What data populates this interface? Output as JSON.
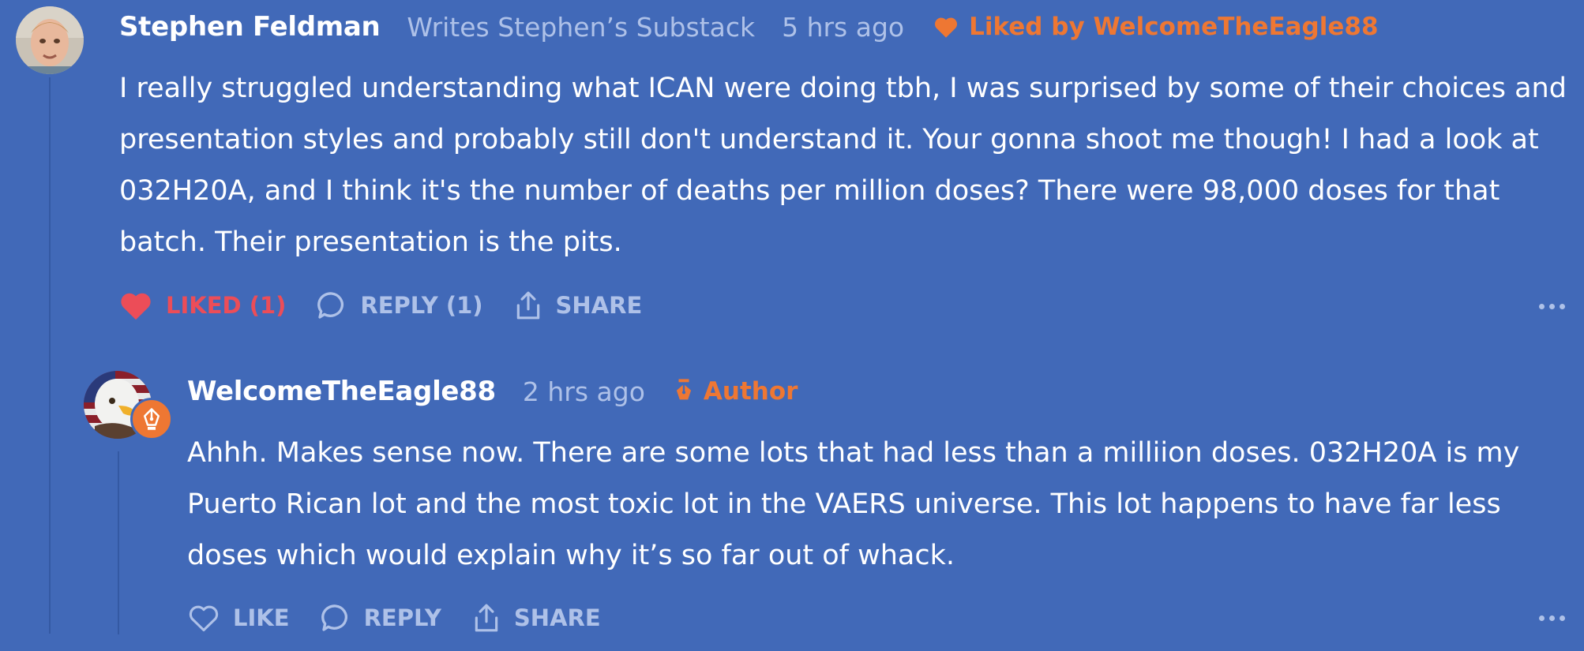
{
  "comments": [
    {
      "author": "Stephen Feldman",
      "subtitle": "Writes Stephen’s Substack",
      "time": "5 hrs ago",
      "liked_by": "Liked by WelcomeTheEagle88",
      "body": "I really struggled understanding what ICAN were doing tbh, I was surprised by some of their choices and presentation styles and probably still don't understand it. Your gonna shoot me though! I had a look at 032H20A, and I think it's the number of deaths per million doses? There were 98,000 doses for that batch. Their presentation is the pits.",
      "actions": {
        "like": "LIKED (1)",
        "reply": "REPLY (1)",
        "share": "SHARE"
      }
    },
    {
      "author": "WelcomeTheEagle88",
      "time": "2 hrs ago",
      "author_tag": "Author",
      "body": "Ahhh. Makes sense now. There are some lots that had less than a milliion doses. 032H20A is my Puerto Rican lot and the most toxic lot in the VAERS universe. This lot happens to have far less doses which would explain why it’s so far out of whack.",
      "actions": {
        "like": "LIKE",
        "reply": "REPLY",
        "share": "SHARE"
      }
    }
  ],
  "icons": {
    "heart": "heart-icon",
    "comment": "comment-bubble-icon",
    "share": "share-icon",
    "pen": "fountain-pen-icon",
    "more": "more-dots-icon"
  },
  "colors": {
    "background": "#4169b8",
    "muted": "#aec1e8",
    "accent_orange": "#ee7733",
    "liked_red": "#ec4d58"
  }
}
